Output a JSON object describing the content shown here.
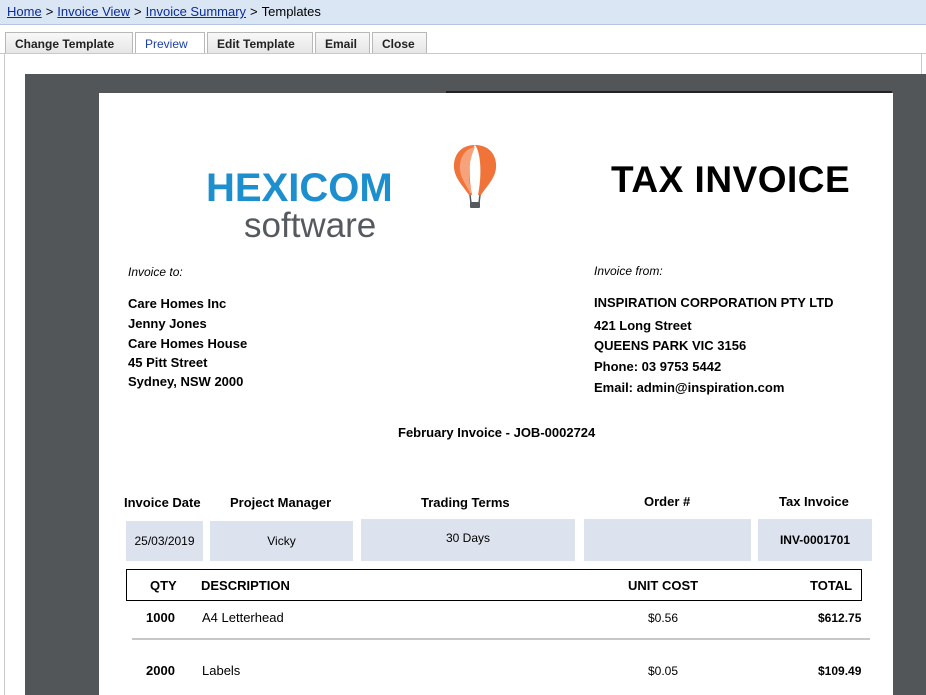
{
  "breadcrumb": {
    "items": [
      "Home",
      "Invoice View",
      "Invoice Summary"
    ],
    "current": "Templates",
    "separator": ">"
  },
  "toolbar": {
    "change_template": "Change Template",
    "preview": "Preview",
    "edit_template": "Edit Template",
    "email": "Email",
    "close": "Close"
  },
  "invoice": {
    "logo": {
      "word1": "HEXICOM",
      "word2": "software",
      "icon": "hot-air-balloon-icon",
      "colors": {
        "blue": "#1e8fce",
        "gray": "#555a5f",
        "orange": "#f0743a"
      }
    },
    "title": "TAX INVOICE",
    "invoice_to_label": "Invoice to:",
    "invoice_to": [
      "Care Homes Inc",
      "Jenny Jones",
      "Care Homes House",
      "45 Pitt Street",
      "Sydney, NSW 2000"
    ],
    "invoice_from_label": "Invoice from:",
    "invoice_from": [
      "INSPIRATION CORPORATION PTY LTD",
      "421 Long Street",
      "QUEENS PARK VIC 3156",
      "Phone: 03 9753 5442",
      "Email: admin@inspiration.com"
    ],
    "heading": "February Invoice - JOB-0002724",
    "info_headers": [
      "Invoice Date",
      "Project Manager",
      "Trading Terms",
      "Order #",
      "Tax Invoice"
    ],
    "info_values": [
      "25/03/2019",
      "Vicky",
      "30 Days",
      "",
      "INV-0001701"
    ],
    "item_headers": {
      "qty": "QTY",
      "description": "DESCRIPTION",
      "unit_cost": "UNIT COST",
      "total": "TOTAL"
    },
    "items": [
      {
        "qty": "1000",
        "description": "A4 Letterhead",
        "unit_cost": "$0.56",
        "total": "$612.75"
      },
      {
        "qty": "2000",
        "description": "Labels",
        "unit_cost": "$0.05",
        "total": "$109.49"
      }
    ]
  }
}
